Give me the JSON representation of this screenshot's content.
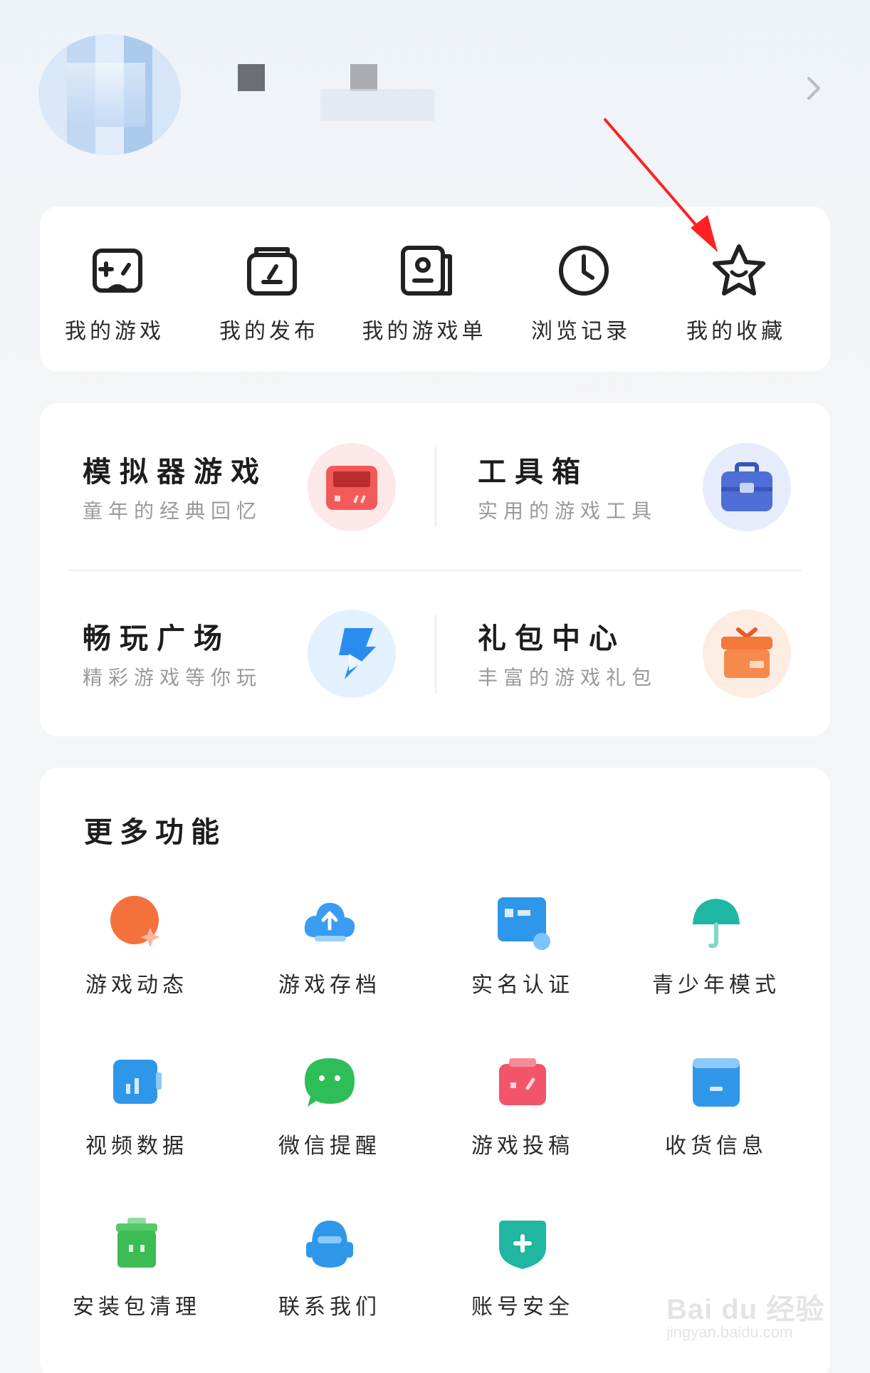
{
  "quick_actions": [
    {
      "label": "我的游戏",
      "icon": "gamepad-icon"
    },
    {
      "label": "我的发布",
      "icon": "publish-icon"
    },
    {
      "label": "我的游戏单",
      "icon": "game-list-icon"
    },
    {
      "label": "浏览记录",
      "icon": "clock-icon"
    },
    {
      "label": "我的收藏",
      "icon": "star-icon"
    }
  ],
  "features": [
    {
      "title": "模拟器游戏",
      "subtitle": "童年的经典回忆",
      "icon": "emulator-icon",
      "color": "#f25a5a"
    },
    {
      "title": "工具箱",
      "subtitle": "实用的游戏工具",
      "icon": "toolbox-icon",
      "color": "#4f6fd6"
    },
    {
      "title": "畅玩广场",
      "subtitle": "精彩游戏等你玩",
      "icon": "play-square-icon",
      "color": "#2b8cf0"
    },
    {
      "title": "礼包中心",
      "subtitle": "丰富的游戏礼包",
      "icon": "gift-icon",
      "color": "#f2793a"
    }
  ],
  "more": {
    "title": "更多功能",
    "items": [
      {
        "label": "游戏动态",
        "icon": "game-news-icon"
      },
      {
        "label": "游戏存档",
        "icon": "cloud-upload-icon"
      },
      {
        "label": "实名认证",
        "icon": "id-card-icon"
      },
      {
        "label": "青少年模式",
        "icon": "umbrella-icon"
      },
      {
        "label": "视频数据",
        "icon": "video-stats-icon"
      },
      {
        "label": "微信提醒",
        "icon": "wechat-icon"
      },
      {
        "label": "游戏投稿",
        "icon": "game-submit-icon"
      },
      {
        "label": "收货信息",
        "icon": "address-icon"
      },
      {
        "label": "安装包清理",
        "icon": "trash-icon"
      },
      {
        "label": "联系我们",
        "icon": "customer-service-icon"
      },
      {
        "label": "账号安全",
        "icon": "shield-icon"
      }
    ]
  },
  "watermark": {
    "brand": "Bai du 经验",
    "url": "jingyan.baidu.com"
  }
}
